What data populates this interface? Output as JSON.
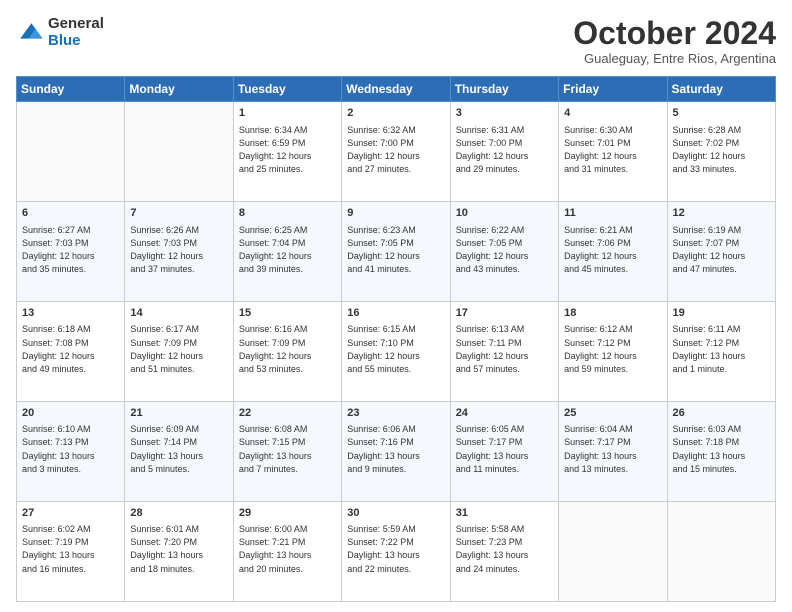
{
  "logo": {
    "general": "General",
    "blue": "Blue"
  },
  "header": {
    "month": "October 2024",
    "location": "Gualeguay, Entre Rios, Argentina"
  },
  "days_of_week": [
    "Sunday",
    "Monday",
    "Tuesday",
    "Wednesday",
    "Thursday",
    "Friday",
    "Saturday"
  ],
  "weeks": [
    [
      {
        "day": "",
        "info": ""
      },
      {
        "day": "",
        "info": ""
      },
      {
        "day": "1",
        "info": "Sunrise: 6:34 AM\nSunset: 6:59 PM\nDaylight: 12 hours\nand 25 minutes."
      },
      {
        "day": "2",
        "info": "Sunrise: 6:32 AM\nSunset: 7:00 PM\nDaylight: 12 hours\nand 27 minutes."
      },
      {
        "day": "3",
        "info": "Sunrise: 6:31 AM\nSunset: 7:00 PM\nDaylight: 12 hours\nand 29 minutes."
      },
      {
        "day": "4",
        "info": "Sunrise: 6:30 AM\nSunset: 7:01 PM\nDaylight: 12 hours\nand 31 minutes."
      },
      {
        "day": "5",
        "info": "Sunrise: 6:28 AM\nSunset: 7:02 PM\nDaylight: 12 hours\nand 33 minutes."
      }
    ],
    [
      {
        "day": "6",
        "info": "Sunrise: 6:27 AM\nSunset: 7:03 PM\nDaylight: 12 hours\nand 35 minutes."
      },
      {
        "day": "7",
        "info": "Sunrise: 6:26 AM\nSunset: 7:03 PM\nDaylight: 12 hours\nand 37 minutes."
      },
      {
        "day": "8",
        "info": "Sunrise: 6:25 AM\nSunset: 7:04 PM\nDaylight: 12 hours\nand 39 minutes."
      },
      {
        "day": "9",
        "info": "Sunrise: 6:23 AM\nSunset: 7:05 PM\nDaylight: 12 hours\nand 41 minutes."
      },
      {
        "day": "10",
        "info": "Sunrise: 6:22 AM\nSunset: 7:05 PM\nDaylight: 12 hours\nand 43 minutes."
      },
      {
        "day": "11",
        "info": "Sunrise: 6:21 AM\nSunset: 7:06 PM\nDaylight: 12 hours\nand 45 minutes."
      },
      {
        "day": "12",
        "info": "Sunrise: 6:19 AM\nSunset: 7:07 PM\nDaylight: 12 hours\nand 47 minutes."
      }
    ],
    [
      {
        "day": "13",
        "info": "Sunrise: 6:18 AM\nSunset: 7:08 PM\nDaylight: 12 hours\nand 49 minutes."
      },
      {
        "day": "14",
        "info": "Sunrise: 6:17 AM\nSunset: 7:09 PM\nDaylight: 12 hours\nand 51 minutes."
      },
      {
        "day": "15",
        "info": "Sunrise: 6:16 AM\nSunset: 7:09 PM\nDaylight: 12 hours\nand 53 minutes."
      },
      {
        "day": "16",
        "info": "Sunrise: 6:15 AM\nSunset: 7:10 PM\nDaylight: 12 hours\nand 55 minutes."
      },
      {
        "day": "17",
        "info": "Sunrise: 6:13 AM\nSunset: 7:11 PM\nDaylight: 12 hours\nand 57 minutes."
      },
      {
        "day": "18",
        "info": "Sunrise: 6:12 AM\nSunset: 7:12 PM\nDaylight: 12 hours\nand 59 minutes."
      },
      {
        "day": "19",
        "info": "Sunrise: 6:11 AM\nSunset: 7:12 PM\nDaylight: 13 hours\nand 1 minute."
      }
    ],
    [
      {
        "day": "20",
        "info": "Sunrise: 6:10 AM\nSunset: 7:13 PM\nDaylight: 13 hours\nand 3 minutes."
      },
      {
        "day": "21",
        "info": "Sunrise: 6:09 AM\nSunset: 7:14 PM\nDaylight: 13 hours\nand 5 minutes."
      },
      {
        "day": "22",
        "info": "Sunrise: 6:08 AM\nSunset: 7:15 PM\nDaylight: 13 hours\nand 7 minutes."
      },
      {
        "day": "23",
        "info": "Sunrise: 6:06 AM\nSunset: 7:16 PM\nDaylight: 13 hours\nand 9 minutes."
      },
      {
        "day": "24",
        "info": "Sunrise: 6:05 AM\nSunset: 7:17 PM\nDaylight: 13 hours\nand 11 minutes."
      },
      {
        "day": "25",
        "info": "Sunrise: 6:04 AM\nSunset: 7:17 PM\nDaylight: 13 hours\nand 13 minutes."
      },
      {
        "day": "26",
        "info": "Sunrise: 6:03 AM\nSunset: 7:18 PM\nDaylight: 13 hours\nand 15 minutes."
      }
    ],
    [
      {
        "day": "27",
        "info": "Sunrise: 6:02 AM\nSunset: 7:19 PM\nDaylight: 13 hours\nand 16 minutes."
      },
      {
        "day": "28",
        "info": "Sunrise: 6:01 AM\nSunset: 7:20 PM\nDaylight: 13 hours\nand 18 minutes."
      },
      {
        "day": "29",
        "info": "Sunrise: 6:00 AM\nSunset: 7:21 PM\nDaylight: 13 hours\nand 20 minutes."
      },
      {
        "day": "30",
        "info": "Sunrise: 5:59 AM\nSunset: 7:22 PM\nDaylight: 13 hours\nand 22 minutes."
      },
      {
        "day": "31",
        "info": "Sunrise: 5:58 AM\nSunset: 7:23 PM\nDaylight: 13 hours\nand 24 minutes."
      },
      {
        "day": "",
        "info": ""
      },
      {
        "day": "",
        "info": ""
      }
    ]
  ]
}
